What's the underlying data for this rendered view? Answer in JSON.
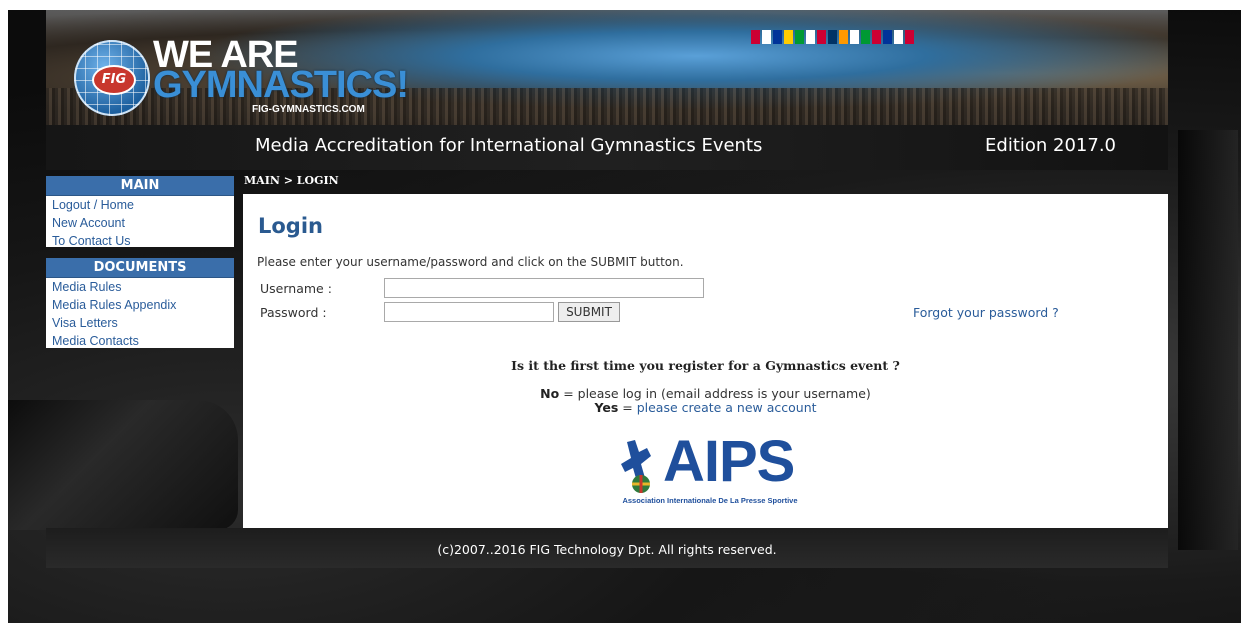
{
  "header": {
    "brand_line1": "WE ARE",
    "brand_line2": "GYMNASTICS!",
    "brand_url": "FIG-GYMNASTICS.COM",
    "logo_badge": "FIG",
    "title": "Media Accreditation for International Gymnastics Events",
    "edition": "Edition 2017.0"
  },
  "breadcrumb": "MAIN > LOGIN",
  "sidebar": {
    "main": {
      "header": "MAIN",
      "items": [
        {
          "label": "Logout / Home"
        },
        {
          "label": "New Account"
        },
        {
          "label": "To Contact Us"
        }
      ]
    },
    "documents": {
      "header": "DOCUMENTS",
      "items": [
        {
          "label": "Media Rules"
        },
        {
          "label": "Media Rules Appendix"
        },
        {
          "label": "Visa Letters"
        },
        {
          "label": "Media Contacts"
        }
      ]
    }
  },
  "login": {
    "title": "Login",
    "instructions": "Please enter your username/password and click on the SUBMIT button.",
    "username_label": "Username :",
    "password_label": "Password :",
    "username_value": "",
    "password_value": "",
    "submit_label": "SUBMIT",
    "forgot_link": "Forgot your password ?"
  },
  "first_time": {
    "question": "Is it the first time you register for a Gymnastics event ?",
    "no_label": "No",
    "no_text": " = please log in (email address is your username)",
    "yes_label": "Yes",
    "yes_eq": " = ",
    "yes_link": "please create a new account"
  },
  "aips_logo": {
    "word": "AIPS",
    "subtitle": "Association Internationale De La Presse Sportive"
  },
  "footer": {
    "copyright": "(c)2007..2016 FIG Technology Dpt. All rights reserved."
  },
  "colors": {
    "nav_header": "#3a6eaa",
    "link": "#2a5c9a",
    "login_title": "#2a5a90",
    "aips_blue": "#1f4f9c"
  }
}
